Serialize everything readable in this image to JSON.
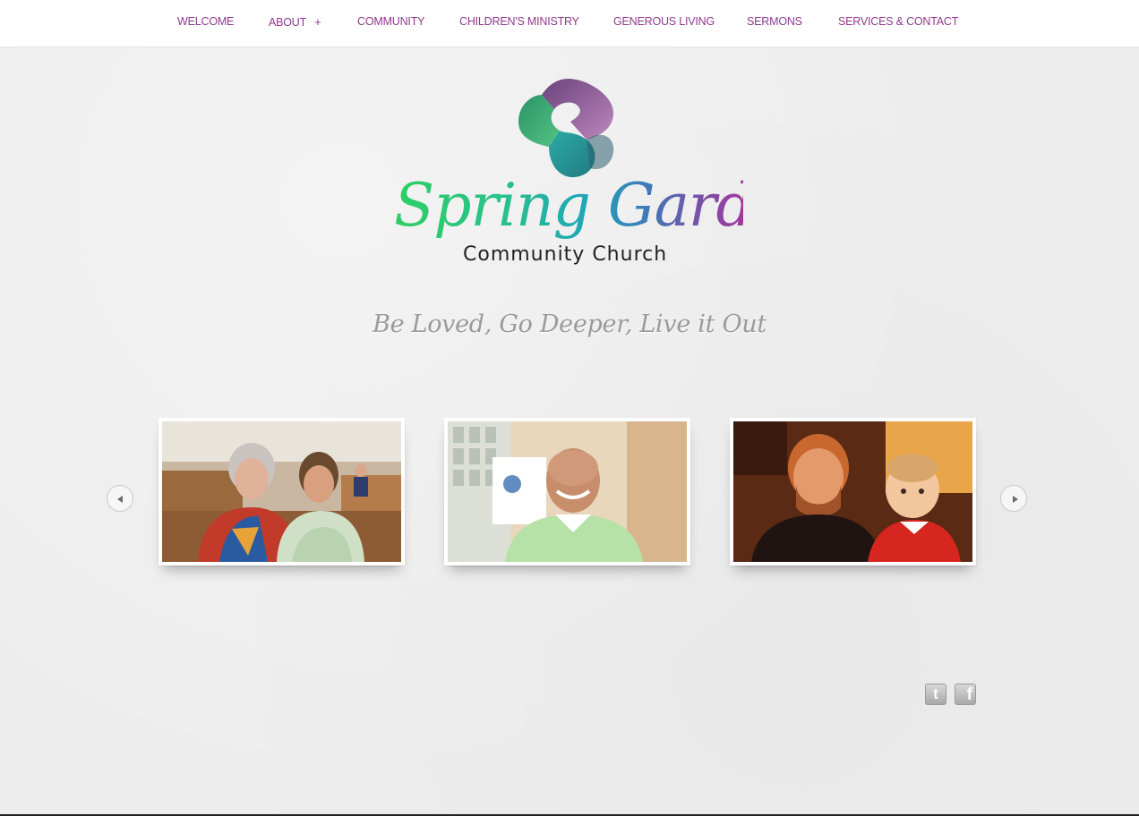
{
  "nav": {
    "items": [
      {
        "label": "WELCOME"
      },
      {
        "label": "ABOUT",
        "suffix": "+"
      },
      {
        "label": "COMMUNITY"
      },
      {
        "label": "CHILDREN'S MINISTRY"
      },
      {
        "label": "GENEROUS LIVING"
      },
      {
        "label": "SERMONS"
      },
      {
        "label": "SERVICES & CONTACT"
      }
    ]
  },
  "logo": {
    "script_text": "Spring Garden",
    "subtitle": "Community Church"
  },
  "tagline": "Be Loved, Go Deeper, Live it Out",
  "carousel": {
    "prev_icon": "arrow-left-icon",
    "next_icon": "arrow-right-icon",
    "slides": [
      {
        "depicts": "two women smiling in church pews"
      },
      {
        "depicts": "smiling bald man in green shirt"
      },
      {
        "depicts": "bearded man holding a toddler"
      }
    ]
  },
  "social": {
    "twitter_glyph": "t",
    "facebook_glyph": "f"
  },
  "colors": {
    "nav_text": "#8e3a8c",
    "tagline": "#9a9a9a",
    "background": "#ededed"
  }
}
